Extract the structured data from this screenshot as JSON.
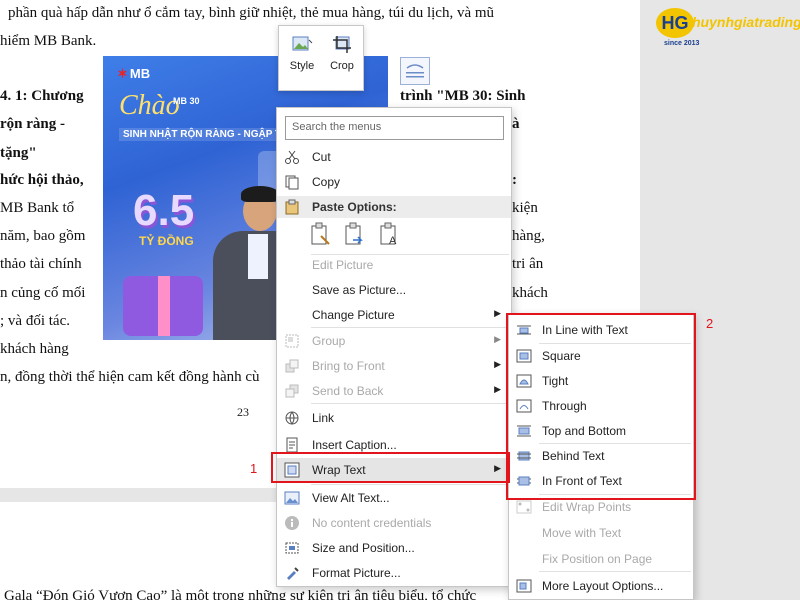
{
  "document": {
    "lines": [
      "phần quà hấp dẫn như ổ cắm tay, bình giữ nhiệt, thẻ mua hàng, túi du lịch, và mũ",
      "hiểm MB Bank."
    ],
    "left_col": [
      "4. 1: Chương",
      " rộn ràng -",
      "tặng\"",
      "hức hội thảo,",
      "MB Bank tổ",
      "năm, bao gồm",
      "thảo tài chính",
      "n củng cố mối",
      "; và đối tác.",
      " khách hàng"
    ],
    "right_col": [
      "trình \"MB 30: Sinh",
      "à",
      ":",
      "kiện",
      "hàng,",
      "tri ân",
      "khách"
    ],
    "bottom_line": "n, đồng thời thể hiện cam kết đồng hành cù",
    "page_number": "23",
    "next_page_line": "Gala “Đón Gió Vươn Cao” là một trong những sự kiện tri ân tiêu biểu, tổ chức"
  },
  "banner": {
    "brand": "MB",
    "greeting": "Chào",
    "sub1": "MB 30",
    "headline": "SINH NHẬT RỘN RÀNG - NGẬP T",
    "big_number": "6.5",
    "big_unit": "TỶ ĐỒNG"
  },
  "logo": {
    "name": "huynhgiatrading",
    "since": "since 2013",
    "mark": "HG"
  },
  "mini_toolbar": {
    "style_label": "Style",
    "crop_label": "Crop"
  },
  "context_menu": {
    "search_placeholder": "Search the menus",
    "cut": "Cut",
    "copy": "Copy",
    "paste_options": "Paste Options:",
    "edit_picture": "Edit Picture",
    "save_as_picture": "Save as Picture...",
    "change_picture": "Change Picture",
    "group": "Group",
    "bring_to_front": "Bring to Front",
    "send_to_back": "Send to Back",
    "link": "Link",
    "insert_caption": "Insert Caption...",
    "wrap_text": "Wrap Text",
    "view_alt_text": "View Alt Text...",
    "content_credentials": "No content credentials",
    "size_and_position": "Size and Position...",
    "format_picture": "Format Picture..."
  },
  "wrap_submenu": {
    "in_line": "In Line with Text",
    "square": "Square",
    "tight": "Tight",
    "through": "Through",
    "top_bottom": "Top and Bottom",
    "behind": "Behind Text",
    "in_front": "In Front of Text",
    "edit_wrap_points": "Edit Wrap Points",
    "move_with_text": "Move with Text",
    "fix_position": "Fix Position on Page",
    "more_layout": "More Layout Options..."
  },
  "annotations": {
    "label1": "1",
    "label2": "2",
    "color": "#e2151c"
  }
}
